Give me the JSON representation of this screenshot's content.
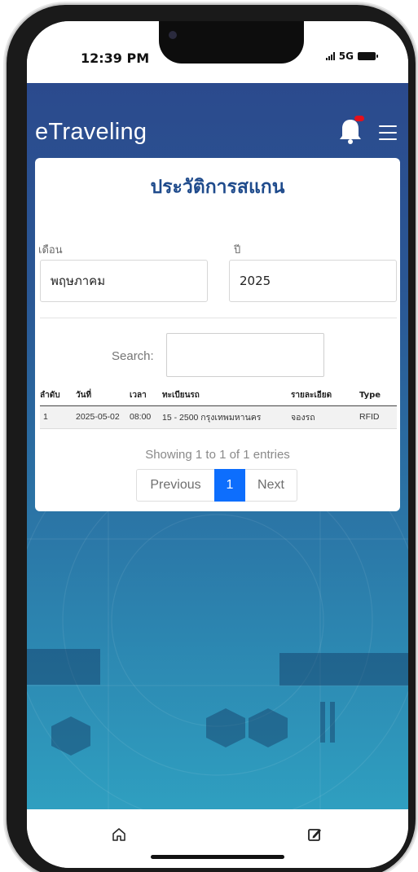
{
  "status_bar": {
    "time": "12:39 PM",
    "network": "5G"
  },
  "header": {
    "brand": "eTraveling",
    "icons": [
      "bell-icon",
      "menu-icon"
    ],
    "notification_dot_color": "#e4101c"
  },
  "card": {
    "title": "ประวัติการสแกน",
    "month_label": "เดือน",
    "month_value": "พฤษภาคม",
    "year_label": "ปี",
    "year_value": "2025",
    "search_label": "Search:",
    "search_value": ""
  },
  "table": {
    "columns": [
      "ลำดับ",
      "วันที่",
      "เวลา",
      "ทะเบียนรถ",
      "รายละเอียด",
      "Type"
    ],
    "rows": [
      [
        "1",
        "2025-05-02",
        "08:00",
        "15 - 2500 กรุงเทพมหานคร",
        "จองรถ",
        "RFID"
      ]
    ]
  },
  "pagination": {
    "info": "Showing 1 to 1 of 1 entries",
    "previous_label": "Previous",
    "current_page": "1",
    "next_label": "Next"
  },
  "bottom_nav": {
    "items": [
      "home-icon",
      "edit-icon"
    ]
  },
  "colors": {
    "app_gradient_top": "#2b4a8d",
    "app_gradient_bottom": "#2f9fc0",
    "title_blue": "#1f4b8c",
    "active_page": "#0d6efd"
  }
}
